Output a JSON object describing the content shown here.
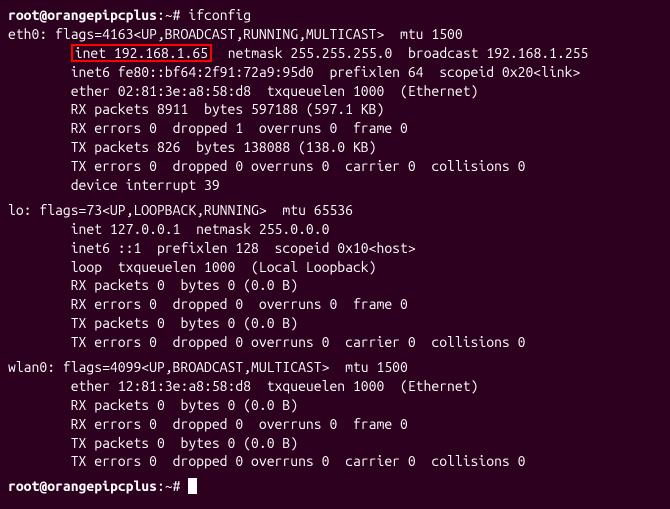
{
  "prompt": {
    "user": "root",
    "host": "orangepipcplus",
    "path": "~",
    "symbol": "#"
  },
  "command": "ifconfig",
  "eth0": {
    "header": "eth0: flags=4163<UP,BROADCAST,RUNNING,MULTICAST>  mtu 1500",
    "inet_label": "inet 192.168.1.65",
    "inet_rest": "  netmask 255.255.255.0  broadcast 192.168.1.255",
    "inet6": "        inet6 fe80::bf64:2f91:72a9:95d0  prefixlen 64  scopeid 0x20<link>",
    "ether": "        ether 02:81:3e:a8:58:d8  txqueuelen 1000  (Ethernet)",
    "rx_packets": "        RX packets 8911  bytes 597188 (597.1 KB)",
    "rx_errors": "        RX errors 0  dropped 1  overruns 0  frame 0",
    "tx_packets": "        TX packets 826  bytes 138088 (138.0 KB)",
    "tx_errors": "        TX errors 0  dropped 0 overruns 0  carrier 0  collisions 0",
    "interrupt": "        device interrupt 39"
  },
  "lo": {
    "header": "lo: flags=73<UP,LOOPBACK,RUNNING>  mtu 65536",
    "inet": "        inet 127.0.0.1  netmask 255.0.0.0",
    "inet6": "        inet6 ::1  prefixlen 128  scopeid 0x10<host>",
    "loop": "        loop  txqueuelen 1000  (Local Loopback)",
    "rx_packets": "        RX packets 0  bytes 0 (0.0 B)",
    "rx_errors": "        RX errors 0  dropped 0  overruns 0  frame 0",
    "tx_packets": "        TX packets 0  bytes 0 (0.0 B)",
    "tx_errors": "        TX errors 0  dropped 0 overruns 0  carrier 0  collisions 0"
  },
  "wlan0": {
    "header": "wlan0: flags=4099<UP,BROADCAST,MULTICAST>  mtu 1500",
    "ether": "        ether 12:81:3e:a8:58:d8  txqueuelen 1000  (Ethernet)",
    "rx_packets": "        RX packets 0  bytes 0 (0.0 B)",
    "rx_errors": "        RX errors 0  dropped 0  overruns 0  frame 0",
    "tx_packets": "        TX packets 0  bytes 0 (0.0 B)",
    "tx_errors": "        TX errors 0  dropped 0 overruns 0  carrier 0  collisions 0"
  },
  "highlight_color": "#ff0000"
}
